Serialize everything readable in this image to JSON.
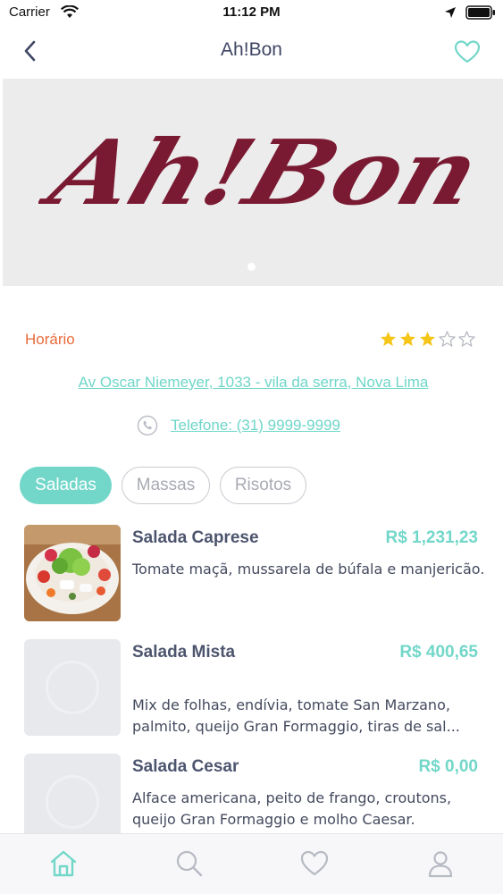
{
  "status_bar": {
    "carrier": "Carrier",
    "time": "11:12 PM"
  },
  "header": {
    "title": "Ah!Bon"
  },
  "banner": {
    "logo_text": "Ah!Bon"
  },
  "info": {
    "hours_label": "Horário",
    "rating": 3,
    "rating_max": 5,
    "address": "Av Oscar Niemeyer, 1033 - vila da serra, Nova Lima",
    "phone": "Telefone: (31) 9999-9999"
  },
  "tabs": [
    {
      "label": "Saladas",
      "active": true
    },
    {
      "label": "Massas",
      "active": false
    },
    {
      "label": "Risotos",
      "active": false
    }
  ],
  "menu": [
    {
      "name": "Salada Caprese",
      "price": "R$ 1,231,23",
      "description": "Tomate maçã, mussarela de búfala e manjericão."
    },
    {
      "name": "Salada Mista",
      "price": "R$ 400,65",
      "description": "Mix de folhas, endívia, tomate San Marzano, palmito, queijo Gran Formaggio, tiras de sal..."
    },
    {
      "name": "Salada Cesar",
      "price": "R$ 0,00",
      "description": "Alface americana, peito de frango, croutons, queijo Gran Formaggio e molho Caesar."
    }
  ],
  "colors": {
    "accent": "#72d7c9",
    "hours": "#e86b3a",
    "star": "#f5c518",
    "logo": "#7a1a32"
  },
  "tab_bar": {
    "icons": [
      "home-icon",
      "search-icon",
      "heart-icon",
      "profile-icon"
    ]
  }
}
